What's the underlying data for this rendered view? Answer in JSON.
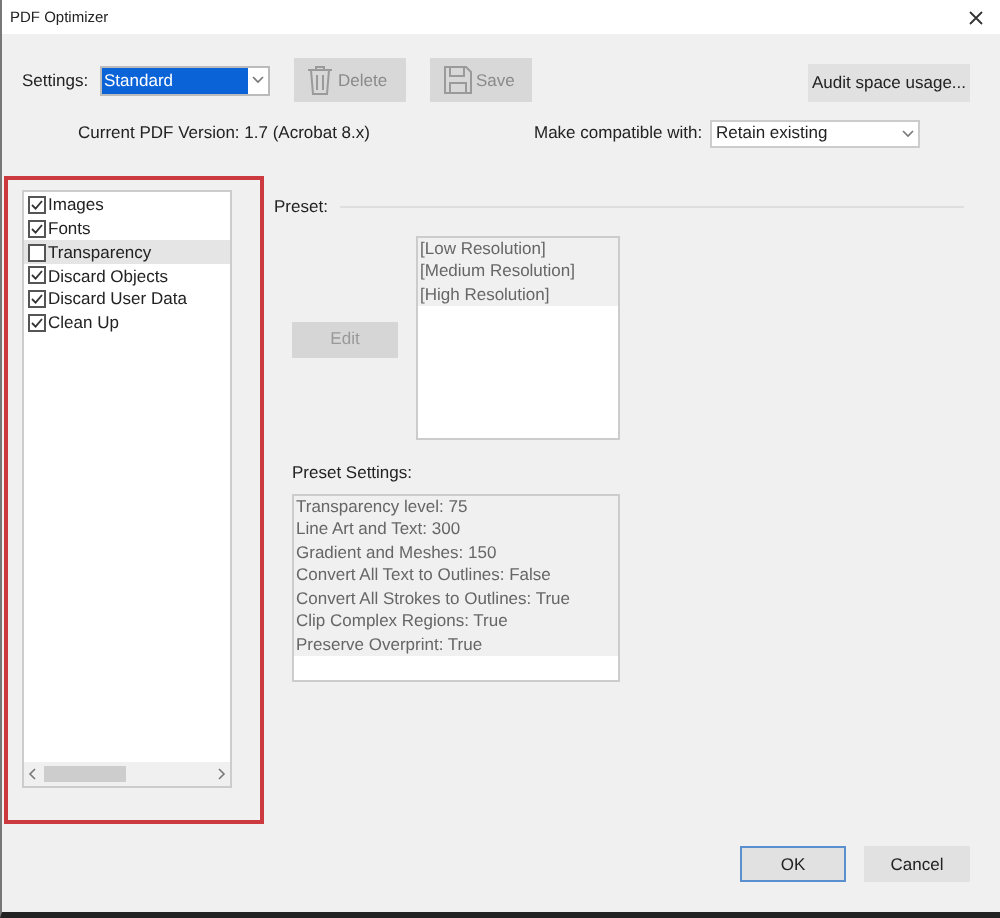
{
  "window": {
    "title": "PDF Optimizer"
  },
  "settings": {
    "label": "Settings:",
    "value": "Standard"
  },
  "toolbar_buttons": [
    {
      "label": "Delete",
      "kind": "delete",
      "disabled": true
    },
    {
      "label": "Save",
      "kind": "save",
      "disabled": true
    }
  ],
  "audit_button": {
    "label": "Audit space usage..."
  },
  "version_text": "Current PDF Version: 1.7 (Acrobat 8.x)",
  "compatibility": {
    "label": "Make compatible with:",
    "value": "Retain existing"
  },
  "categories_highlighted": true,
  "categories": [
    {
      "label": "Images",
      "checked": true,
      "selected": false
    },
    {
      "label": "Fonts",
      "checked": true,
      "selected": false
    },
    {
      "label": "Transparency",
      "checked": false,
      "selected": true
    },
    {
      "label": "Discard Objects",
      "checked": true,
      "selected": false
    },
    {
      "label": "Discard User Data",
      "checked": true,
      "selected": false
    },
    {
      "label": "Clean Up",
      "checked": true,
      "selected": false
    }
  ],
  "preset": {
    "label": "Preset:",
    "edit_button": {
      "label": "Edit",
      "disabled": true
    },
    "items": [
      "[Low Resolution]",
      "[Medium Resolution]",
      "[High Resolution]"
    ]
  },
  "preset_settings": {
    "label": "Preset Settings:",
    "items": [
      "Transparency level: 75",
      "Line Art and Text: 300",
      "Gradient and Meshes: 150",
      "Convert All Text to Outlines: False",
      "Convert All Strokes to Outlines: True",
      "Clip Complex Regions: True",
      "Preserve Overprint: True"
    ]
  },
  "dialog_buttons": [
    {
      "label": "OK",
      "default": true
    },
    {
      "label": "Cancel",
      "default": false
    }
  ]
}
